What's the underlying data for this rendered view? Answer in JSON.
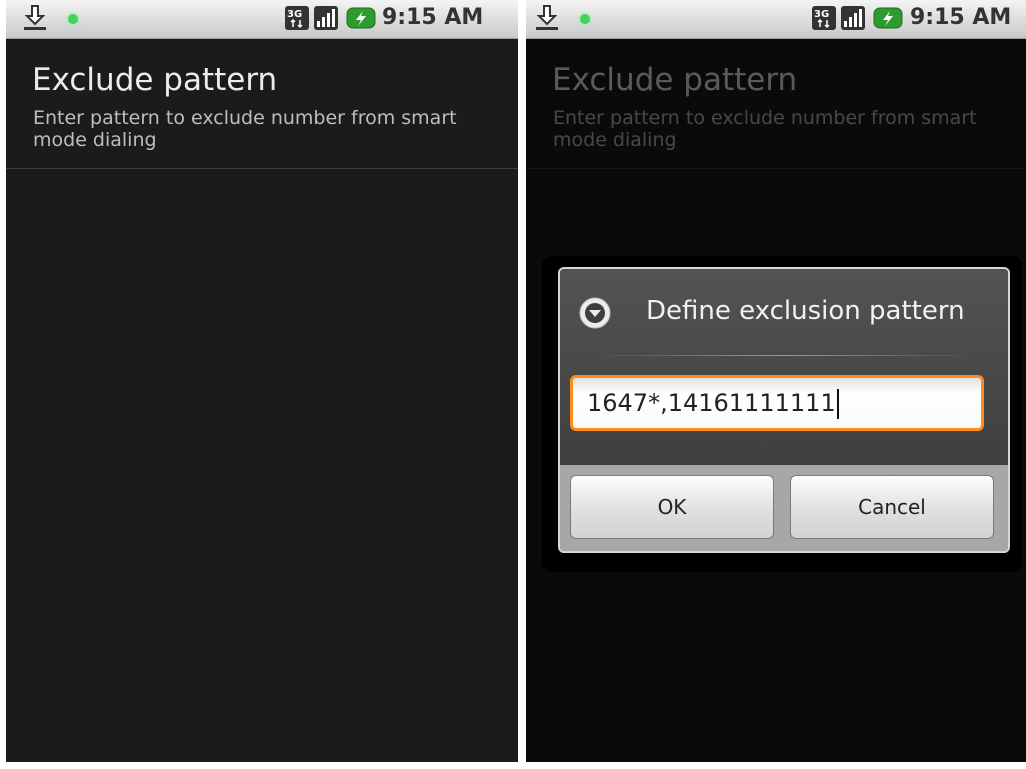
{
  "status_bar": {
    "time": "9:15 AM",
    "icons": [
      "download-icon",
      "notification-dot-icon",
      "3g-data-icon",
      "signal-strength-icon",
      "battery-charging-icon"
    ],
    "network_label": "3G"
  },
  "preference": {
    "title": "Exclude pattern",
    "summary": "Enter pattern to exclude number from smart mode dialing"
  },
  "dialog": {
    "icon": "dropdown-circle-icon",
    "title": "Define exclusion pattern",
    "input_value": "1647*,14161111111",
    "ok_label": "OK",
    "cancel_label": "Cancel"
  },
  "colors": {
    "background": "#1b1b1b",
    "accent_focus": "#ff8c1a",
    "notification_green": "#3fd45a"
  }
}
